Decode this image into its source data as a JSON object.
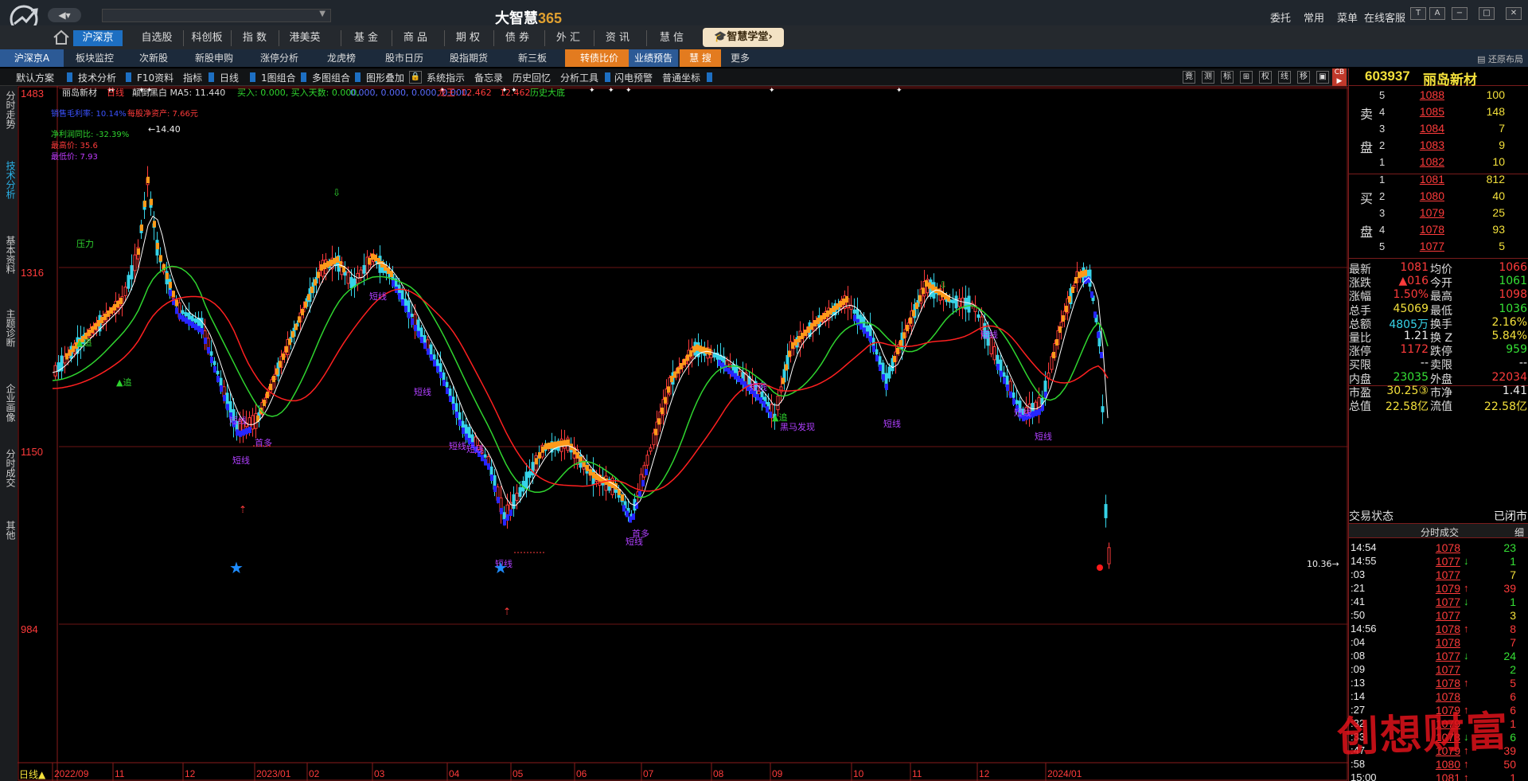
{
  "app": {
    "title_main": "大智慧",
    "title_num": "365",
    "menu": [
      "委托",
      "常用",
      "菜单",
      "在线客服"
    ]
  },
  "modules": [
    "沪深京",
    "自选股",
    "科创板",
    "指 数",
    "港美英",
    "基 金",
    "商 品",
    "期 权",
    "债 券",
    "外 汇",
    "资 讯",
    "慧 信"
  ],
  "academy": "智慧学堂›",
  "subtabs": [
    "沪深京A",
    "板块监控",
    "次新股",
    "新股申购",
    "涨停分析",
    "龙虎榜",
    "股市日历",
    "股指期货",
    "新三板",
    "转债比价",
    "业绩预告",
    "慧 搜",
    "更多"
  ],
  "restore_layout": "还原布局",
  "toolbar": [
    "默认方案",
    "技术分析",
    "F10资料",
    "指标",
    "日线",
    "1图组合",
    "多图组合",
    "图形叠加",
    "系统指示",
    "备忘录",
    "历史回忆",
    "分析工具",
    "闪电预警",
    "普通坐标"
  ],
  "toolbar_icons": [
    "竟",
    "测",
    "标",
    "⊞",
    "权",
    "线",
    "移",
    "▣",
    "▶"
  ],
  "left_tabs": [
    "分时走势",
    "技术分析",
    "基本资料",
    "主题诊断",
    "企业画像",
    "分时成交",
    "其他"
  ],
  "chart": {
    "header_name": "丽岛新材",
    "header_period": "日线",
    "header_rest": "颠倒黑白 MA5: 11.440",
    "buy_in": "买入: 0.000, 买入天数: 0.000,",
    "blue_vals": "0.000, 0.000, 0.000, 0.000,",
    "dragon": "龙王: 12.462",
    "dragon2": "12.462",
    "history": "历史大底",
    "info_margin": "销售毛利率: 10.14%",
    "info_nav": "每股净资产: 7.66元",
    "info_profit": "净利润同比: -32.39%",
    "info_high": "最高价: 35.6",
    "info_low": "最低价: 7.93",
    "y_ticks": [
      "1483",
      "1316",
      "1150",
      "984"
    ],
    "x_ticks": [
      "2022/09",
      "11",
      "12",
      "2023/01",
      "02",
      "03",
      "04",
      "05",
      "06",
      "07",
      "08",
      "09",
      "10",
      "11",
      "12",
      "2024/01"
    ],
    "period_label": "日线▲",
    "high_mark": "14.40",
    "low_mark": "10.36",
    "tags": {
      "pressure": "压力",
      "chase": "追",
      "short_line": "短线",
      "bull": "首多",
      "dark_horse": "黑马发现"
    }
  },
  "quote": {
    "code": "603937",
    "name": "丽岛新材",
    "ask_label": [
      "卖",
      "盘"
    ],
    "bid_label": [
      "买",
      "盘"
    ],
    "asks": [
      {
        "i": "5",
        "p": "1088",
        "v": "100"
      },
      {
        "i": "4",
        "p": "1085",
        "v": "148"
      },
      {
        "i": "3",
        "p": "1084",
        "v": "7"
      },
      {
        "i": "2",
        "p": "1083",
        "v": "9"
      },
      {
        "i": "1",
        "p": "1082",
        "v": "10"
      }
    ],
    "bids": [
      {
        "i": "1",
        "p": "1081",
        "v": "812"
      },
      {
        "i": "2",
        "p": "1080",
        "v": "40"
      },
      {
        "i": "3",
        "p": "1079",
        "v": "25"
      },
      {
        "i": "4",
        "p": "1078",
        "v": "93"
      },
      {
        "i": "5",
        "p": "1077",
        "v": "5"
      }
    ],
    "stats": [
      {
        "l": "最新",
        "v": "1081",
        "c": "red",
        "l2": "均价",
        "v2": "1066",
        "c2": "red"
      },
      {
        "l": "涨跌",
        "v": "▲016",
        "c": "red",
        "l2": "今开",
        "v2": "1061",
        "c2": "green"
      },
      {
        "l": "涨幅",
        "v": "1.50%",
        "c": "red",
        "l2": "最高",
        "v2": "1098",
        "c2": "red"
      },
      {
        "l": "总手",
        "v": "45069",
        "c": "yellow",
        "l2": "最低",
        "v2": "1036",
        "c2": "green"
      },
      {
        "l": "总额",
        "v": "4805万",
        "c": "cyan",
        "l2": "换手",
        "v2": "2.16%",
        "c2": "yellow"
      },
      {
        "l": "量比",
        "v": "1.21",
        "c": "white",
        "l2": "换 Z",
        "v2": "5.84%",
        "c2": "yellow"
      },
      {
        "l": "涨停",
        "v": "1172",
        "c": "red",
        "l2": "跌停",
        "v2": "959",
        "c2": "green"
      },
      {
        "l": "买限",
        "v": "--",
        "c": "white",
        "l2": "卖限",
        "v2": "--",
        "c2": "white"
      },
      {
        "l": "内盘",
        "v": "23035",
        "c": "green",
        "l2": "外盘",
        "v2": "22034",
        "c2": "red"
      },
      {
        "l": "市盈",
        "v": "30.25③",
        "c": "yellow",
        "l2": "市净",
        "v2": "1.41",
        "c2": "white"
      },
      {
        "l": "总值",
        "v": "22.58亿",
        "c": "yellow",
        "l2": "流值",
        "v2": "22.58亿",
        "c2": "yellow"
      }
    ],
    "trade_state_label": "交易状态",
    "trade_state": "已闭市",
    "ticks_title": "分时成交",
    "ticks_detail": "细",
    "ticks": [
      {
        "t": "14:54",
        "p": "1078",
        "pc": "red",
        "a": "",
        "ac": "",
        "v": "23",
        "vc": "green"
      },
      {
        "t": "14:55",
        "p": "1077",
        "pc": "red",
        "a": "↓",
        "ac": "green",
        "v": "1",
        "vc": "green"
      },
      {
        "t": ":03",
        "p": "1077",
        "pc": "red",
        "a": "",
        "ac": "",
        "v": "7",
        "vc": "yellow"
      },
      {
        "t": ":21",
        "p": "1079",
        "pc": "red",
        "a": "↑",
        "ac": "red",
        "v": "39",
        "vc": "red"
      },
      {
        "t": ":41",
        "p": "1077",
        "pc": "red",
        "a": "↓",
        "ac": "green",
        "v": "1",
        "vc": "green"
      },
      {
        "t": ":50",
        "p": "1077",
        "pc": "red",
        "a": "",
        "ac": "",
        "v": "3",
        "vc": "yellow"
      },
      {
        "t": "14:56",
        "p": "1078",
        "pc": "red",
        "a": "↑",
        "ac": "red",
        "v": "8",
        "vc": "red"
      },
      {
        "t": ":04",
        "p": "1078",
        "pc": "red",
        "a": "",
        "ac": "",
        "v": "7",
        "vc": "red"
      },
      {
        "t": ":08",
        "p": "1077",
        "pc": "red",
        "a": "↓",
        "ac": "green",
        "v": "24",
        "vc": "green"
      },
      {
        "t": ":09",
        "p": "1077",
        "pc": "red",
        "a": "",
        "ac": "",
        "v": "2",
        "vc": "green"
      },
      {
        "t": ":13",
        "p": "1078",
        "pc": "red",
        "a": "↑",
        "ac": "red",
        "v": "5",
        "vc": "red"
      },
      {
        "t": ":14",
        "p": "1078",
        "pc": "red",
        "a": "",
        "ac": "",
        "v": "6",
        "vc": "red"
      },
      {
        "t": ":27",
        "p": "1079",
        "pc": "red",
        "a": "↑",
        "ac": "red",
        "v": "6",
        "vc": "red"
      },
      {
        "t": ":32",
        "p": "1079",
        "pc": "red",
        "a": "",
        "ac": "",
        "v": "1",
        "vc": "red"
      },
      {
        "t": ":33",
        "p": "1078",
        "pc": "red",
        "a": "↓",
        "ac": "green",
        "v": "6",
        "vc": "green"
      },
      {
        "t": ":47",
        "p": "1079",
        "pc": "red",
        "a": "↑",
        "ac": "red",
        "v": "39",
        "vc": "red"
      },
      {
        "t": ":58",
        "p": "1080",
        "pc": "red",
        "a": "↑",
        "ac": "red",
        "v": "50",
        "vc": "red"
      },
      {
        "t": "15:00",
        "p": "1081",
        "pc": "red",
        "a": "↑",
        "ac": "red",
        "v": "1",
        "vc": "red"
      }
    ]
  },
  "watermark": "创想财富",
  "colors": {
    "up": "#ff3b3b",
    "down": "#36d3e8",
    "ma_green": "#2fd52f",
    "ma_red": "#ff2020",
    "blue_trend": "#2626ff",
    "orange_trend": "#ff9a1a"
  }
}
